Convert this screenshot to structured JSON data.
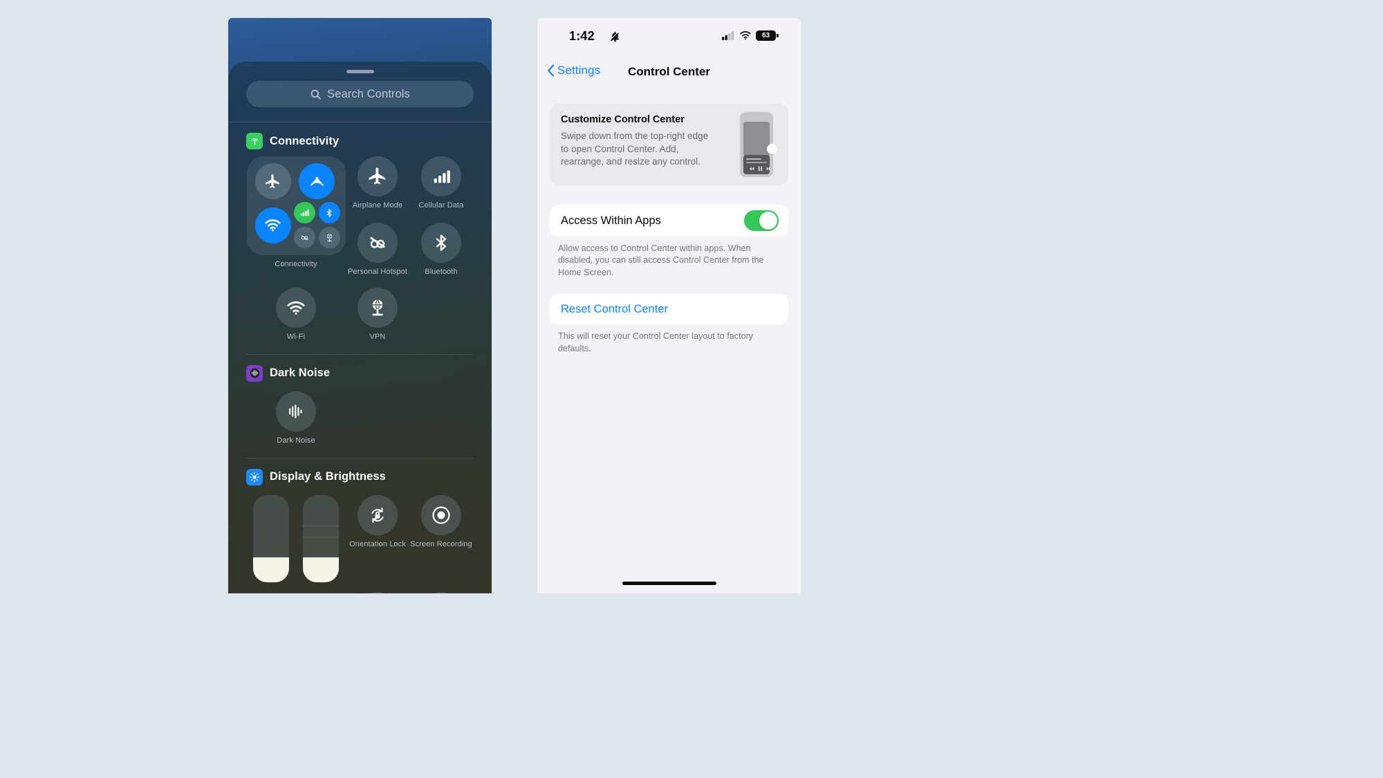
{
  "left_phone": {
    "search": {
      "placeholder": "Search Controls",
      "icon": "search-icon"
    },
    "sections": [
      {
        "id": "connectivity",
        "app_icon": "broadcast-icon",
        "app_icon_color": "#3cd063",
        "title": "Connectivity",
        "module": {
          "label": "Connectivity",
          "controls": [
            {
              "name": "airplane-mode",
              "icon": "airplane-icon",
              "state": "off",
              "color": "#a9bdc9"
            },
            {
              "name": "airdrop",
              "icon": "airdrop-icon",
              "state": "on",
              "color": "#0a84ff"
            },
            {
              "name": "wifi",
              "icon": "wifi-icon",
              "state": "on",
              "color": "#0a84ff"
            },
            {
              "name": "cellular-data",
              "icon": "cellular-bars-icon",
              "state": "on",
              "color": "#34c759"
            },
            {
              "name": "bluetooth",
              "icon": "bluetooth-icon",
              "state": "on",
              "color": "#0a84ff"
            },
            {
              "name": "personal-hotspot",
              "icon": "hotspot-icon",
              "state": "off",
              "color": "#a9bdc9"
            },
            {
              "name": "vpn",
              "icon": "vpn-globe-icon",
              "state": "off",
              "color": "#a9bdc9"
            }
          ]
        },
        "tiles": [
          {
            "label": "Airplane Mode",
            "icon": "airplane-icon",
            "state": "off"
          },
          {
            "label": "Cellular Data",
            "icon": "cellular-bars-icon",
            "state": "off"
          },
          {
            "label": "Personal Hotspot",
            "icon": "hotspot-off-icon",
            "state": "off"
          },
          {
            "label": "Bluetooth",
            "icon": "bluetooth-icon",
            "state": "off"
          },
          {
            "label": "Wi-Fi",
            "icon": "wifi-icon",
            "state": "off"
          },
          {
            "label": "VPN",
            "icon": "vpn-globe-icon",
            "state": "off"
          }
        ]
      },
      {
        "id": "dark-noise",
        "app_icon": "waveform-icon",
        "app_icon_color": "#7a3ec8",
        "title": "Dark Noise",
        "tiles": [
          {
            "label": "Dark Noise",
            "icon": "waveform-icon",
            "state": "off"
          }
        ]
      },
      {
        "id": "display-brightness",
        "app_icon": "brightness-sun-icon",
        "app_icon_color": "#1f8af7",
        "title": "Display & Brightness",
        "sliders": [
          {
            "name": "brightness-slider",
            "fill_percent": 28
          },
          {
            "name": "true-tone-slider",
            "fill_percent": 28
          }
        ],
        "tiles": [
          {
            "label": "Orientation Lock",
            "icon": "rotation-lock-icon",
            "state": "off"
          },
          {
            "label": "Screen Recording",
            "icon": "record-icon",
            "state": "off"
          }
        ]
      }
    ]
  },
  "right_phone": {
    "status_bar": {
      "time": "1:42",
      "silent_icon": "bell-slash-icon",
      "signal_icon": "cellular-signal-icon",
      "wifi_icon": "wifi-icon",
      "battery_level": "63"
    },
    "nav": {
      "back_label": "Settings",
      "back_icon": "chevron-left-icon",
      "title": "Control Center"
    },
    "info_card": {
      "title": "Customize Control Center",
      "body": "Swipe down from the top-right edge to open Control Center. Add, rearrange, and resize any control.",
      "illustration": "phone-control-center-illustration"
    },
    "access_row": {
      "label": "Access Within Apps",
      "toggle_state": "on",
      "toggle_color": "#34c759"
    },
    "access_footnote": "Allow access to Control Center within apps. When disabled, you can still access Control Center from the Home Screen.",
    "reset_row": {
      "label": "Reset Control Center",
      "color": "#0a84ff"
    },
    "reset_footnote": "This will reset your Control Center layout to factory defaults."
  }
}
